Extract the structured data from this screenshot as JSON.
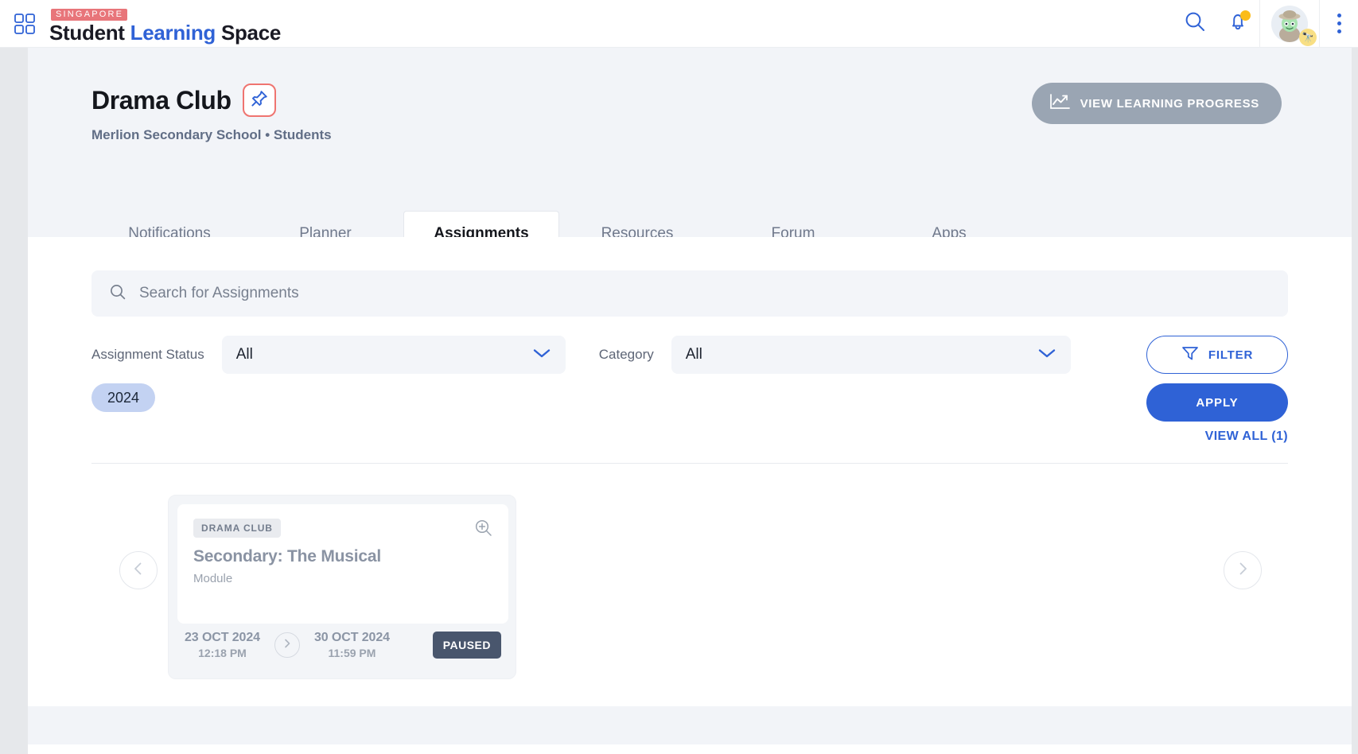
{
  "topbar": {
    "grid_icon": "grid-apps-icon",
    "logo": {
      "tag": "SINGAPORE",
      "word1": "Student",
      "word2": "Learning",
      "word3": "Space"
    },
    "search_icon": "search-icon",
    "notifications_icon": "bell-icon",
    "avatar": "user-avatar",
    "menu_icon": "kebab-menu-icon"
  },
  "header": {
    "title": "Drama Club",
    "pin_icon": "pin-icon",
    "subtitle": "Merlion Secondary School • Students",
    "progress_button": {
      "label": "VIEW LEARNING PROGRESS",
      "icon": "line-chart-icon"
    }
  },
  "tabs": [
    {
      "label": "Notifications",
      "active": false
    },
    {
      "label": "Planner",
      "active": false
    },
    {
      "label": "Assignments",
      "active": true
    },
    {
      "label": "Resources",
      "active": false
    },
    {
      "label": "Forum",
      "active": false
    },
    {
      "label": "Apps",
      "active": false
    }
  ],
  "search": {
    "placeholder": "Search for Assignments",
    "value": "",
    "icon": "search-icon"
  },
  "filters": {
    "status_label": "Assignment Status",
    "status_value": "All",
    "category_label": "Category",
    "category_value": "All",
    "filter_button": "FILTER",
    "filter_icon": "funnel-icon",
    "apply_button": "APPLY",
    "year_chip": "2024",
    "view_all": "VIEW ALL (1)"
  },
  "carousel": {
    "prev_icon": "chevron-left-icon",
    "next_icon": "chevron-right-icon",
    "cards": [
      {
        "badge": "DRAMA CLUB",
        "title": "Secondary: The Musical",
        "subtitle": "Module",
        "zoom_icon": "zoom-in-icon",
        "start_date": "23 OCT 2024",
        "start_time": "12:18 PM",
        "arrow_icon": "chevron-right-icon",
        "end_date": "30 OCT 2024",
        "end_time": "11:59 PM",
        "status": "PAUSED"
      }
    ]
  },
  "colors": {
    "brand_blue": "#2f62d6",
    "accent_red": "#ef7470",
    "notification_yellow": "#fbbc19",
    "status_dark": "#49566d",
    "chip_blue": "#c3d2f2"
  }
}
